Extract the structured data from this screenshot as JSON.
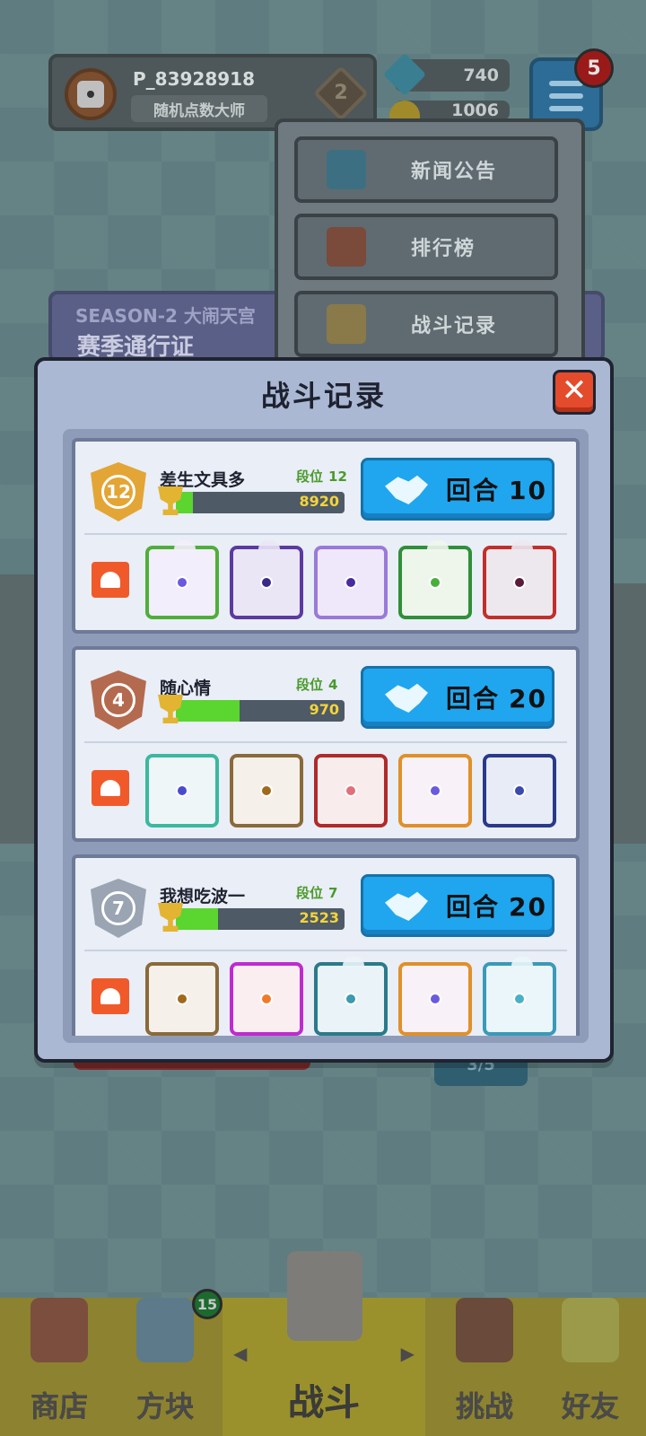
{
  "profile": {
    "player_id": "P_83928918",
    "title": "随机点数大师",
    "rank_level": "2"
  },
  "currency": {
    "gems": "740",
    "coins": "1006"
  },
  "menu": {
    "notification_count": "5",
    "items": [
      {
        "label": "新闻公告",
        "icon": "monitor-icon",
        "color": "#3d8fb5"
      },
      {
        "label": "排行榜",
        "icon": "leaderboard-icon",
        "color": "#b84a3a"
      },
      {
        "label": "战斗记录",
        "icon": "sword-icon",
        "color": "#b9a04a"
      }
    ]
  },
  "season": {
    "line1": "SEASON-2 大闹天宫",
    "line2": "赛季通行证"
  },
  "background_stub": "3/5",
  "modal": {
    "title": "战斗记录",
    "close_label": "✕",
    "records": [
      {
        "rank": "12",
        "rank_color": "#e3a535",
        "name": "差生文具多",
        "tier_label": "段位",
        "tier": "12",
        "trophies": "8920",
        "trophy_fill": 0.1,
        "rounds_label": "回合",
        "rounds": "10",
        "dice": [
          {
            "name": "infinity-dragon-die",
            "border": "#4fae3a",
            "pip": "#6a5ae0",
            "bg": "#f3eefb"
          },
          {
            "name": "purple-dragon-die",
            "border": "#5c3aa0",
            "pip": "#3a2a8a",
            "bg": "#eae6f6"
          },
          {
            "name": "lightning-die",
            "border": "#9a7ad8",
            "pip": "#4a2aa0",
            "bg": "#efe8fa"
          },
          {
            "name": "green-dragon-die",
            "border": "#2f8f3a",
            "pip": "#4aae3a",
            "bg": "#eef6ec"
          },
          {
            "name": "vortex-dragon-die",
            "border": "#c0302a",
            "pip": "#5a1a3a",
            "bg": "#ece8ee"
          }
        ]
      },
      {
        "rank": "4",
        "rank_color": "#b46a4e",
        "name": "随心情",
        "tier_label": "段位",
        "tier": "4",
        "trophies": "970",
        "trophy_fill": 0.38,
        "rounds_label": "回合",
        "rounds": "20",
        "dice": [
          {
            "name": "growth-die",
            "border": "#3ab8a0",
            "pip": "#4a4ad0",
            "bg": "#eef6f8"
          },
          {
            "name": "mystery-die",
            "border": "#8a6a3a",
            "pip": "#a06a1a",
            "bg": "#f5f0ea"
          },
          {
            "name": "crack-die",
            "border": "#b02a2a",
            "pip": "#e0707a",
            "bg": "#f8ecec"
          },
          {
            "name": "rainbow-die",
            "border": "#e0902a",
            "pip": "#6a5ae0",
            "bg": "#f8f2f8"
          },
          {
            "name": "gear-die",
            "border": "#2a3a8a",
            "pip": "#3a4ab0",
            "bg": "#e8ecf6"
          }
        ]
      },
      {
        "rank": "7",
        "rank_color": "#9aa4b2",
        "name": "我想吃波一",
        "tier_label": "段位",
        "tier": "7",
        "trophies": "2523",
        "trophy_fill": 0.25,
        "rounds_label": "回合",
        "rounds": "20",
        "dice": [
          {
            "name": "mystery-die",
            "border": "#8a6a3a",
            "pip": "#a06a1a",
            "bg": "#f5f0ea"
          },
          {
            "name": "sun-die",
            "border": "#c02ad0",
            "pip": "#f07a2a",
            "bg": "#fbeef0"
          },
          {
            "name": "whirlwind-dragon-die",
            "border": "#2a7a8a",
            "pip": "#3a9ab0",
            "bg": "#eaf4f8"
          },
          {
            "name": "rainbow-die",
            "border": "#e0902a",
            "pip": "#6a5ae0",
            "bg": "#f8f2f8"
          },
          {
            "name": "ice-dragon-die",
            "border": "#3a9ab8",
            "pip": "#4ab0c8",
            "bg": "#eaf6fa"
          }
        ]
      }
    ]
  },
  "bottom_nav": {
    "items": [
      {
        "label": "商店",
        "icon": "shop-icon"
      },
      {
        "label": "方块",
        "icon": "dice-box-icon"
      },
      {
        "label": "战斗",
        "icon": "battle-shield-icon"
      },
      {
        "label": "挑战",
        "icon": "challenge-icon"
      },
      {
        "label": "好友",
        "icon": "friends-icon"
      }
    ],
    "dice_badge": "15",
    "arrow_left": "◀",
    "arrow_right": "▶"
  }
}
